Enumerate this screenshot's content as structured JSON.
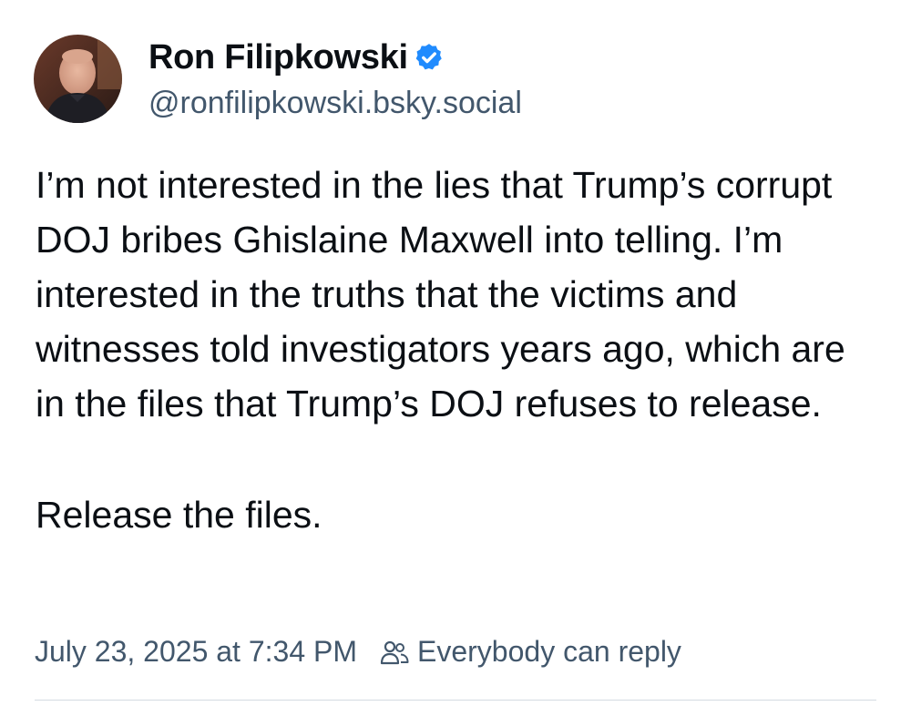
{
  "author": {
    "display_name": "Ron Filipkowski",
    "handle": "@ronfilipkowski.bsky.social",
    "verified": true,
    "verified_color": "#208bfe"
  },
  "post": {
    "paragraphs": [
      "I’m not interested in the lies that Trump’s corrupt DOJ bribes Ghislaine Maxwell into telling. I’m interested in the truths that the victims and witnesses told investigators years ago, which are in the files that Trump’s DOJ refuses to release.",
      "Release the files."
    ]
  },
  "meta": {
    "timestamp": "July 23, 2025 at 7:34 PM",
    "reply_setting_icon": "people-icon",
    "reply_setting": "Everybody can reply"
  },
  "colors": {
    "text": "#0b0f14",
    "secondary": "#42576c",
    "divider": "#d4dbe2"
  }
}
